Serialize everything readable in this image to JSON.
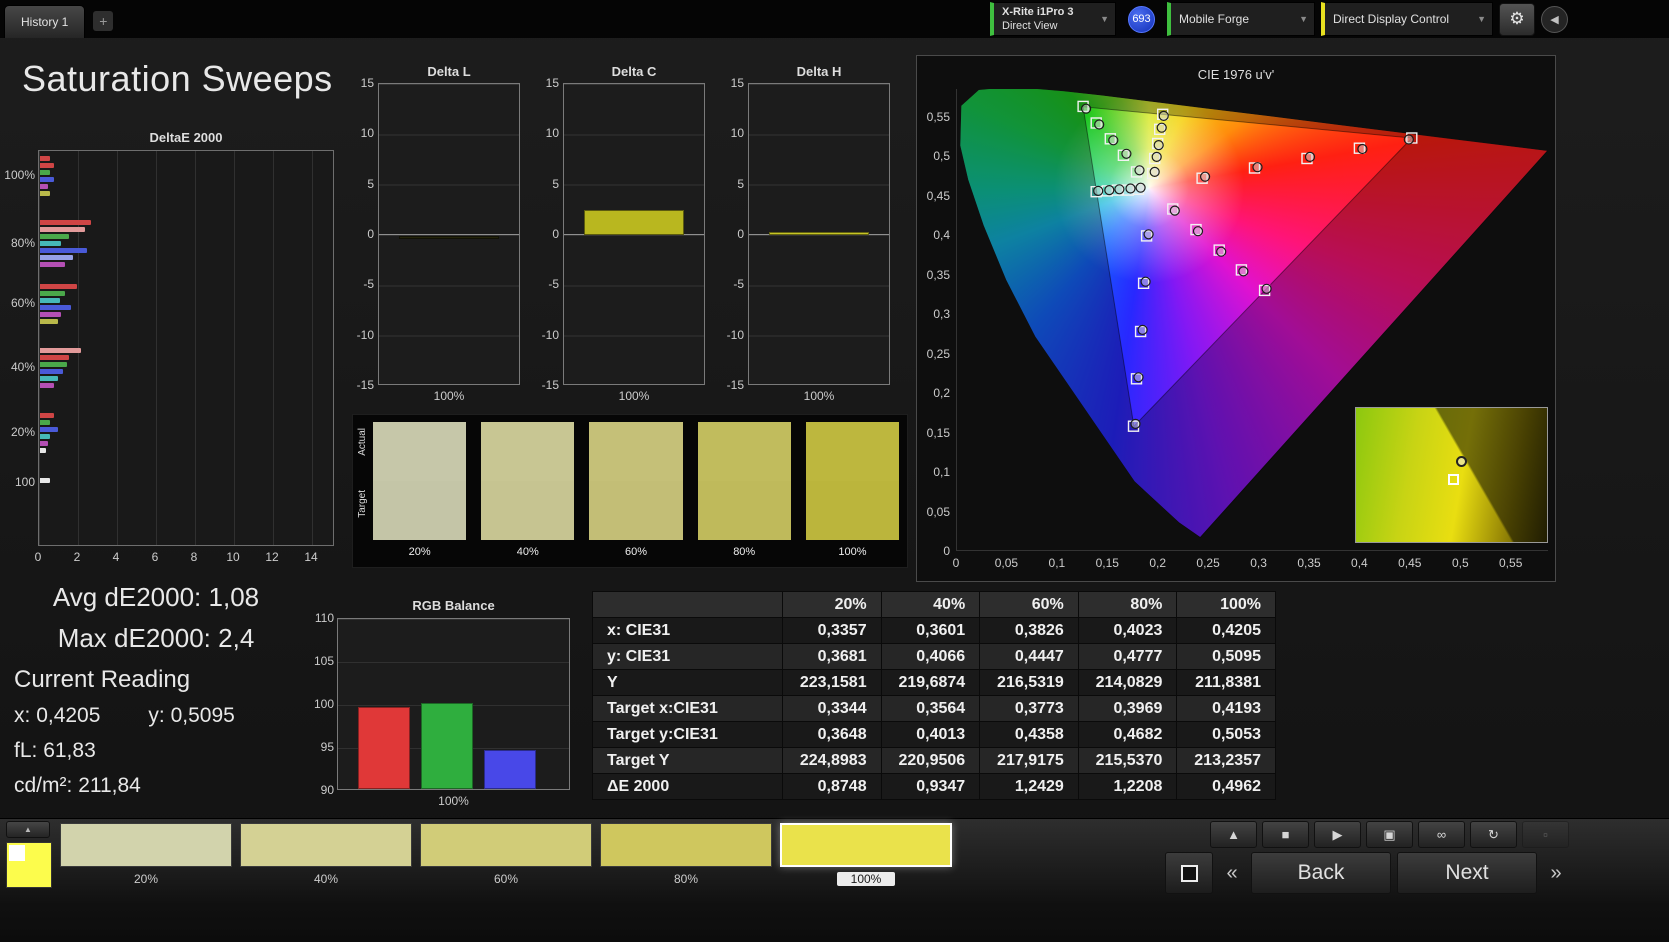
{
  "topbar": {
    "history_tab": "History 1",
    "add_tab": "+",
    "meter": {
      "line1": "X-Rite i1Pro 3",
      "line2": "Direct View"
    },
    "badge": "693",
    "source": "Mobile Forge",
    "display_control": "Direct Display Control",
    "colors": {
      "green_accent": "#3fbf3f",
      "yellow_accent": "#e8e020",
      "badge_blue": "#1f49d7"
    }
  },
  "title": "Saturation Sweeps",
  "stats": {
    "avg_label": "Avg dE2000:",
    "avg_value": "1,08",
    "max_label": "Max dE2000:",
    "max_value": "2,4",
    "section_title": "Current Reading",
    "x_label": "x:",
    "x_value": "0,4205",
    "y_label": "y:",
    "y_value": "0,5095",
    "fl_label": "fL:",
    "fl_value": "61,83",
    "cd_label": "cd/m²:",
    "cd_value": "211,84"
  },
  "saturation_swatches": {
    "row_labels": [
      "Actual",
      "Target"
    ],
    "levels": [
      "20%",
      "40%",
      "60%",
      "80%",
      "100%"
    ],
    "actual_colors": [
      "#c6c7a9",
      "#c8c693",
      "#c5c078",
      "#c1bc5d",
      "#bdb73e"
    ],
    "target_colors": [
      "#c4c5a7",
      "#c6c491",
      "#c3be76",
      "#bfba5b",
      "#bbb53c"
    ]
  },
  "table": {
    "col_headers": [
      "",
      "20%",
      "40%",
      "60%",
      "80%",
      "100%"
    ],
    "rows": [
      {
        "label": "x: CIE31",
        "values": [
          "0,3357",
          "0,3601",
          "0,3826",
          "0,4023",
          "0,4205"
        ]
      },
      {
        "label": "y: CIE31",
        "values": [
          "0,3681",
          "0,4066",
          "0,4447",
          "0,4777",
          "0,5095"
        ]
      },
      {
        "label": "Y",
        "values": [
          "223,1581",
          "219,6874",
          "216,5319",
          "214,0829",
          "211,8381"
        ]
      },
      {
        "label": "Target x:CIE31",
        "values": [
          "0,3344",
          "0,3564",
          "0,3773",
          "0,3969",
          "0,4193"
        ]
      },
      {
        "label": "Target y:CIE31",
        "values": [
          "0,3648",
          "0,4013",
          "0,4358",
          "0,4682",
          "0,5053"
        ]
      },
      {
        "label": "Target Y",
        "values": [
          "224,8983",
          "220,9506",
          "217,9175",
          "215,5370",
          "213,2357"
        ]
      },
      {
        "label": "ΔE 2000",
        "values": [
          "0,8748",
          "0,9347",
          "1,2429",
          "1,2208",
          "0,4962"
        ]
      }
    ]
  },
  "chart_data": [
    {
      "id": "deltae2000",
      "type": "bar",
      "orientation": "horizontal",
      "title": "DeltaE 2000",
      "xlim": [
        0,
        14
      ],
      "xticks": [
        0,
        2,
        4,
        6,
        8,
        10,
        12,
        14
      ],
      "groups": [
        {
          "label": "100%",
          "bars": [
            {
              "color": "#cf4545",
              "value": 0.5
            },
            {
              "color": "#cf4545",
              "value": 0.7
            },
            {
              "color": "#4aa84a",
              "value": 0.5
            },
            {
              "color": "#4a5ad8",
              "value": 0.7
            },
            {
              "color": "#b44fb4",
              "value": 0.4
            },
            {
              "color": "#b9b94a",
              "value": 0.5
            }
          ]
        },
        {
          "label": "80%",
          "bars": [
            {
              "color": "#cf4545",
              "value": 2.6
            },
            {
              "color": "#e29a9a",
              "value": 2.3
            },
            {
              "color": "#4aa84a",
              "value": 1.5
            },
            {
              "color": "#46b8b8",
              "value": 1.1
            },
            {
              "color": "#4a5ad8",
              "value": 2.4
            },
            {
              "color": "#97a1e6",
              "value": 1.7
            },
            {
              "color": "#b44fb4",
              "value": 1.3
            }
          ]
        },
        {
          "label": "60%",
          "bars": [
            {
              "color": "#cf4545",
              "value": 1.9
            },
            {
              "color": "#4aa84a",
              "value": 1.3
            },
            {
              "color": "#46b8b8",
              "value": 1.0
            },
            {
              "color": "#4a5ad8",
              "value": 1.6
            },
            {
              "color": "#b44fb4",
              "value": 1.1
            },
            {
              "color": "#b9b94a",
              "value": 0.9
            }
          ]
        },
        {
          "label": "40%",
          "bars": [
            {
              "color": "#e29a9a",
              "value": 2.1
            },
            {
              "color": "#cf4545",
              "value": 1.5
            },
            {
              "color": "#4aa84a",
              "value": 1.4
            },
            {
              "color": "#4a5ad8",
              "value": 1.2
            },
            {
              "color": "#46b8b8",
              "value": 0.9
            },
            {
              "color": "#b44fb4",
              "value": 0.7
            }
          ]
        },
        {
          "label": "20%",
          "bars": [
            {
              "color": "#cf4545",
              "value": 0.7
            },
            {
              "color": "#4aa84a",
              "value": 0.5
            },
            {
              "color": "#4a5ad8",
              "value": 0.9
            },
            {
              "color": "#46b8b8",
              "value": 0.5
            },
            {
              "color": "#b44fb4",
              "value": 0.4
            },
            {
              "color": "#e6e6e6",
              "value": 0.3
            }
          ]
        },
        {
          "label": "100",
          "bars": [
            {
              "color": "#e6e6e6",
              "value": 0.5
            }
          ]
        }
      ]
    },
    {
      "id": "delta_l",
      "type": "bar",
      "title": "Delta L",
      "ylim": [
        -15,
        15
      ],
      "yticks": [
        15,
        10,
        5,
        0,
        -5,
        -10,
        -15
      ],
      "xlabel": "100%",
      "value": -0.3,
      "color": "#23230a"
    },
    {
      "id": "delta_c",
      "type": "bar",
      "title": "Delta C",
      "ylim": [
        -15,
        15
      ],
      "yticks": [
        15,
        10,
        5,
        0,
        -5,
        -10,
        -15
      ],
      "xlabel": "100%",
      "value": 2.5,
      "color": "#b9b71f"
    },
    {
      "id": "delta_h",
      "type": "bar",
      "title": "Delta H",
      "ylim": [
        -15,
        15
      ],
      "yticks": [
        15,
        10,
        5,
        0,
        -5,
        -10,
        -15
      ],
      "xlabel": "100%",
      "value": 0.3,
      "color": "#c6c426"
    },
    {
      "id": "rgb_balance",
      "type": "bar",
      "title": "RGB Balance",
      "ylim": [
        90,
        110
      ],
      "yticks": [
        110,
        105,
        100,
        95,
        90
      ],
      "xlabel": "100%",
      "categories": [
        "Red",
        "Green",
        "Blue"
      ],
      "values": [
        99.5,
        100,
        94.5
      ],
      "colors": [
        "#e03838",
        "#2fae3e",
        "#4848e8"
      ]
    },
    {
      "id": "cie",
      "type": "scatter",
      "title": "CIE 1976 u'v'",
      "xlim": [
        0,
        0.587
      ],
      "ylim": [
        0,
        0.585
      ],
      "xticks": [
        "0",
        "0,05",
        "0,1",
        "0,15",
        "0,2",
        "0,25",
        "0,3",
        "0,35",
        "0,4",
        "0,45",
        "0,5",
        "0,55"
      ],
      "yticks": [
        "0,55",
        "0,5",
        "0,45",
        "0,4",
        "0,35",
        "0,3",
        "0,25",
        "0,2",
        "0,15",
        "0,1",
        "0,05",
        "0"
      ],
      "white_point": [
        0.191,
        0.459
      ],
      "gamut_triangle": [
        [
          0.451,
          0.523
        ],
        [
          0.125,
          0.5625
        ],
        [
          0.1754,
          0.1579
        ]
      ],
      "targets": [
        [
          0.194,
          0.478
        ],
        [
          0.196,
          0.497
        ],
        [
          0.199,
          0.516
        ],
        [
          0.201,
          0.534
        ],
        [
          0.204,
          0.553
        ],
        [
          0.243,
          0.472
        ],
        [
          0.295,
          0.485
        ],
        [
          0.347,
          0.497
        ],
        [
          0.399,
          0.51
        ],
        [
          0.451,
          0.523
        ],
        [
          0.178,
          0.48
        ],
        [
          0.165,
          0.501
        ],
        [
          0.152,
          0.522
        ],
        [
          0.138,
          0.542
        ],
        [
          0.125,
          0.563
        ],
        [
          0.188,
          0.399
        ],
        [
          0.185,
          0.339
        ],
        [
          0.182,
          0.278
        ],
        [
          0.178,
          0.218
        ],
        [
          0.175,
          0.158
        ],
        [
          0.18,
          0.458
        ],
        [
          0.17,
          0.457
        ],
        [
          0.159,
          0.457
        ],
        [
          0.149,
          0.456
        ],
        [
          0.138,
          0.455
        ],
        [
          0.214,
          0.433
        ],
        [
          0.237,
          0.407
        ],
        [
          0.26,
          0.381
        ],
        [
          0.282,
          0.356
        ],
        [
          0.305,
          0.33
        ]
      ],
      "measurements": [
        [
          0.196,
          0.48
        ],
        [
          0.198,
          0.499
        ],
        [
          0.2,
          0.514
        ],
        [
          0.203,
          0.536
        ],
        [
          0.205,
          0.551
        ],
        [
          0.246,
          0.474
        ],
        [
          0.298,
          0.486
        ],
        [
          0.35,
          0.499
        ],
        [
          0.402,
          0.509
        ],
        [
          0.448,
          0.521
        ],
        [
          0.181,
          0.482
        ],
        [
          0.168,
          0.503
        ],
        [
          0.155,
          0.52
        ],
        [
          0.141,
          0.54
        ],
        [
          0.128,
          0.56
        ],
        [
          0.19,
          0.401
        ],
        [
          0.187,
          0.341
        ],
        [
          0.184,
          0.28
        ],
        [
          0.18,
          0.22
        ],
        [
          0.177,
          0.161
        ],
        [
          0.182,
          0.46
        ],
        [
          0.172,
          0.459
        ],
        [
          0.161,
          0.458
        ],
        [
          0.151,
          0.457
        ],
        [
          0.14,
          0.456
        ],
        [
          0.216,
          0.431
        ],
        [
          0.239,
          0.405
        ],
        [
          0.262,
          0.379
        ],
        [
          0.284,
          0.354
        ],
        [
          0.307,
          0.332
        ]
      ]
    }
  ],
  "bottombar": {
    "preview": {
      "color": "#fcfc4c"
    },
    "expand_icon": "▲",
    "swatches": [
      {
        "label": "20%",
        "color": "#d2d3ac"
      },
      {
        "label": "40%",
        "color": "#d4d194"
      },
      {
        "label": "60%",
        "color": "#d1cc78"
      },
      {
        "label": "80%",
        "color": "#cfc75e"
      },
      {
        "label": "100%",
        "color": "#eae24b",
        "selected": true
      }
    ],
    "transport": [
      {
        "name": "collapse-panel-button",
        "glyph": "▲"
      },
      {
        "name": "stop-button",
        "glyph": "■"
      },
      {
        "name": "play-button",
        "glyph": "▶"
      },
      {
        "name": "measure-window-button",
        "glyph": "▣"
      },
      {
        "name": "continuous-read-button",
        "glyph": "∞"
      },
      {
        "name": "repeat-button",
        "glyph": "↻"
      },
      {
        "name": "inactive-button",
        "glyph": "▫"
      }
    ],
    "nav": {
      "prev_icon": "«",
      "back": "Back",
      "next": "Next",
      "next_icon": "»"
    }
  }
}
